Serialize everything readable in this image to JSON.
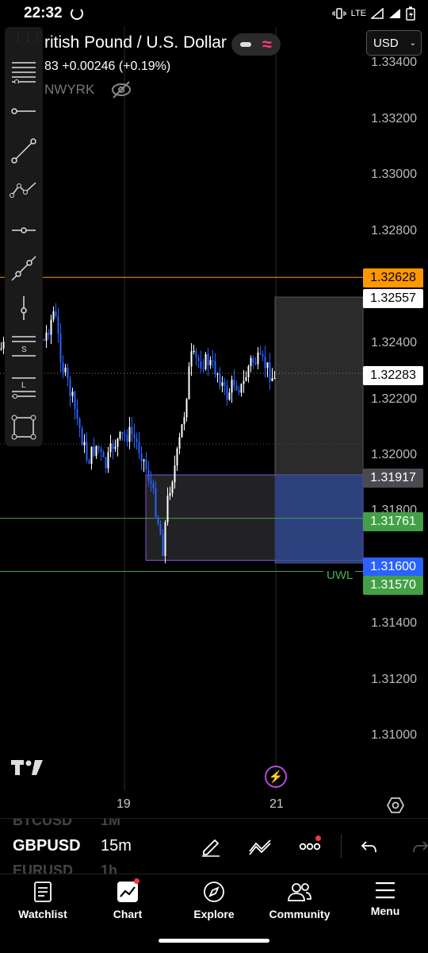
{
  "status_bar": {
    "time": "22:32",
    "network": "LTE"
  },
  "header": {
    "symbol_title": "ritish Pound / U.S. Dollar",
    "price_change": "83  +0.00246 (+0.19%)",
    "exchange": "NWYRK",
    "currency": "USD"
  },
  "price_axis": {
    "labels": [
      "1.33400",
      "1.33200",
      "1.33000",
      "1.32800",
      "1.32400",
      "1.32200",
      "1.32000",
      "1.31800",
      "1.31400",
      "1.31200",
      "1.31000"
    ]
  },
  "price_tags": [
    {
      "text": "1.32628",
      "bg": "#ff9800",
      "fg": "#000000"
    },
    {
      "text": "1.32557",
      "bg": "#ffffff",
      "fg": "#000000"
    },
    {
      "text": "1.32283",
      "bg": "#ffffff",
      "fg": "#000000"
    },
    {
      "text": "1.31917",
      "bg": "#4a4a52",
      "fg": "#ffffff"
    },
    {
      "text": "1.31761",
      "bg": "#43a047",
      "fg": "#ffffff"
    },
    {
      "text": "1.31600",
      "bg": "#2962ff",
      "fg": "#ffffff"
    },
    {
      "text": "1.31570",
      "bg": "#43a047",
      "fg": "#ffffff"
    }
  ],
  "uwl_label": "UWL",
  "time_axis": {
    "labels": [
      "19",
      "21"
    ]
  },
  "bottom_toolbar": {
    "symbols_ghost": [
      "BTCUSD",
      "EURUSD"
    ],
    "timeframes_ghost": [
      "1M",
      "1h"
    ],
    "symbol": "GBPUSD",
    "timeframe": "15m"
  },
  "nav": {
    "items": [
      {
        "label": "Watchlist",
        "icon": "watchlist-icon"
      },
      {
        "label": "Chart",
        "icon": "chart-icon"
      },
      {
        "label": "Explore",
        "icon": "compass-icon"
      },
      {
        "label": "Community",
        "icon": "community-icon"
      },
      {
        "label": "Menu",
        "icon": "hamburger-icon"
      }
    ]
  },
  "colors": {
    "up": "#ffffff",
    "down": "#2962ff",
    "orange_line": "#ff9800",
    "green_line": "#43a047",
    "accent": "#f23645"
  },
  "chart_data": {
    "type": "candlestick",
    "symbol": "GBPUSD",
    "interval": "15m",
    "ylim": [
      1.3095,
      1.3344
    ],
    "horizontal_lines": [
      {
        "price": 1.32628,
        "color": "#ff9800"
      },
      {
        "price": 1.31761,
        "color": "#43a047"
      },
      {
        "price": 1.3157,
        "color": "#43a047",
        "label": "UWL"
      },
      {
        "price": 1.32283,
        "style": "dotted"
      }
    ],
    "zones": [
      {
        "from": 1.31917,
        "to": 1.316
      },
      {
        "from": 1.32557,
        "to": 1.316
      }
    ]
  }
}
